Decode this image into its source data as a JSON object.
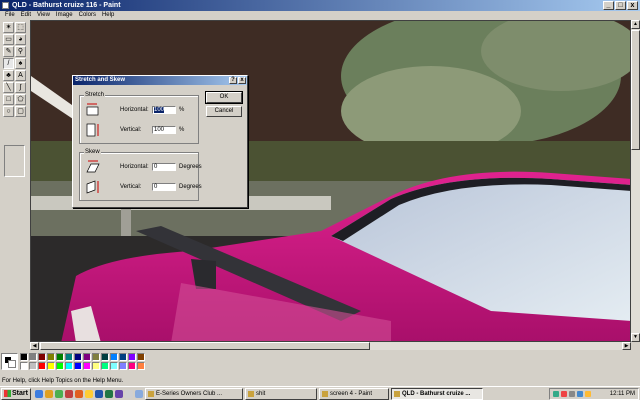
{
  "window": {
    "title": "QLD - Bathurst cruize 116 - Paint",
    "buttons": {
      "minimize": "_",
      "maximize": "□",
      "close": "x"
    }
  },
  "menu": [
    "File",
    "Edit",
    "View",
    "Image",
    "Colors",
    "Help"
  ],
  "tools": [
    "free-select",
    "select",
    "eraser",
    "fill",
    "color-picker",
    "magnifier",
    "pencil",
    "brush",
    "airbrush",
    "text",
    "line",
    "curve",
    "rectangle",
    "polygon",
    "ellipse",
    "rounded-rectangle"
  ],
  "dialog": {
    "title": "Stretch and Skew",
    "help_btn": "?",
    "close_btn": "x",
    "stretch": {
      "label": "Stretch",
      "horizontal_label": "Horizontal:",
      "horizontal_value": "100",
      "horizontal_unit": "%",
      "vertical_label": "Vertical:",
      "vertical_value": "100",
      "vertical_unit": "%"
    },
    "skew": {
      "label": "Skew",
      "horizontal_label": "Horizontal:",
      "horizontal_value": "0",
      "horizontal_unit": "Degrees",
      "vertical_label": "Vertical:",
      "vertical_value": "0",
      "vertical_unit": "Degrees"
    },
    "ok": "OK",
    "cancel": "Cancel"
  },
  "palette": [
    "#000000",
    "#808080",
    "#800000",
    "#808000",
    "#008000",
    "#008080",
    "#000080",
    "#800080",
    "#808040",
    "#004040",
    "#0080ff",
    "#004080",
    "#8000ff",
    "#804000",
    "#ffffff",
    "#c0c0c0",
    "#ff0000",
    "#ffff00",
    "#00ff00",
    "#00ffff",
    "#0000ff",
    "#ff00ff",
    "#ffff80",
    "#00ff80",
    "#80ffff",
    "#8080ff",
    "#ff0080",
    "#ff8040"
  ],
  "status": "For Help, click Help Topics on the Help Menu.",
  "taskbar": {
    "start": "Start",
    "tasks": [
      "E-Series Owners Club ...",
      "shit",
      "screen 4 - Paint",
      "QLD - Bathurst cruize ..."
    ],
    "clock": "12:11 PM"
  }
}
